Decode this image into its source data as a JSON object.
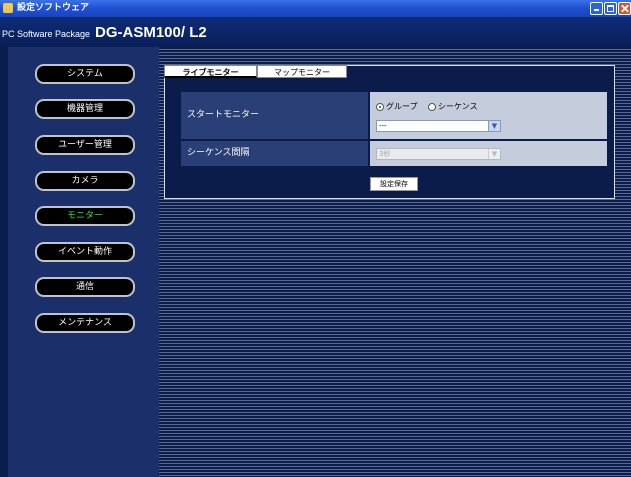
{
  "window": {
    "title": "設定ソフトウェア"
  },
  "header": {
    "package_label": "PC Software Package",
    "model": "DG-ASM100/ L2"
  },
  "sidebar": {
    "items": [
      {
        "label": "システム",
        "active": false
      },
      {
        "label": "機器管理",
        "active": false
      },
      {
        "label": "ユーザー管理",
        "active": false
      },
      {
        "label": "カメラ",
        "active": false
      },
      {
        "label": "モニター",
        "active": true
      },
      {
        "label": "イベント動作",
        "active": false
      },
      {
        "label": "通信",
        "active": false
      },
      {
        "label": "メンテナンス",
        "active": false
      }
    ]
  },
  "tabs": [
    {
      "label": "ライブモニター",
      "selected": true
    },
    {
      "label": "マップモニター",
      "selected": false
    }
  ],
  "form": {
    "start_monitor": {
      "label": "スタートモニター",
      "radio_group": "グループ",
      "radio_sequence": "シーケンス",
      "selected": "group",
      "select_value": "---"
    },
    "sequence_interval": {
      "label": "シーケンス間隔",
      "select_value": "3秒",
      "disabled": true
    },
    "save_label": "設定保存"
  },
  "colors": {
    "active_nav": "#2eea3c",
    "title_bar": "#1f4fd0"
  }
}
